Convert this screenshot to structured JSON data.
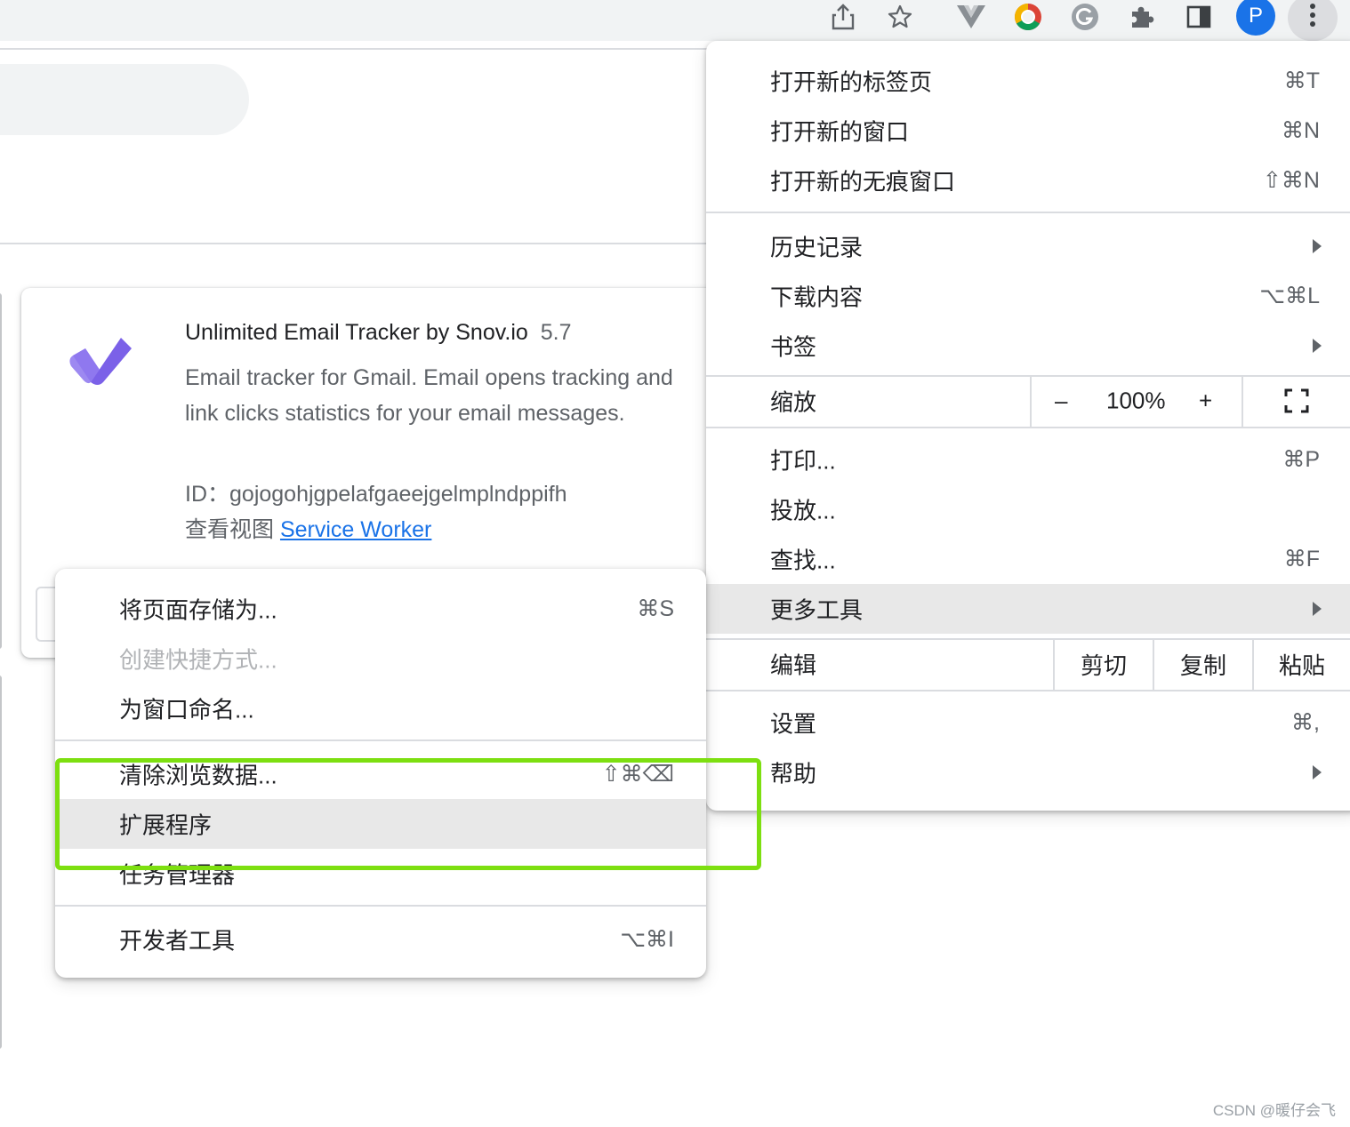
{
  "toolbar": {
    "avatar_letter": "P",
    "icons": [
      "share-icon",
      "star-icon",
      "vue-devtools-icon",
      "chrome-color-icon",
      "grammarly-icon",
      "puzzle-icon",
      "side-panel-icon",
      "avatar",
      "more-vert-icon"
    ]
  },
  "extension": {
    "name": "Unlimited Email Tracker by Snov.io",
    "version": "5.7",
    "description": "Email tracker for Gmail. Email opens tracking and link clicks statistics for your email messages.",
    "id_label": "ID：",
    "id_value": "gojogohjgpelafgaeejgelmplndppifh",
    "views_label": "查看视图",
    "service_worker_link": "Service Worker",
    "logo_color": "#7b61e8"
  },
  "main_menu": {
    "new_tab": {
      "label": "打开新的标签页",
      "shortcut": "⌘T"
    },
    "new_window": {
      "label": "打开新的窗口",
      "shortcut": "⌘N"
    },
    "new_incognito": {
      "label": "打开新的无痕窗口",
      "shortcut": "⇧⌘N"
    },
    "history": {
      "label": "历史记录"
    },
    "downloads": {
      "label": "下载内容",
      "shortcut": "⌥⌘L"
    },
    "bookmarks": {
      "label": "书签"
    },
    "zoom": {
      "label": "缩放",
      "minus": "–",
      "value": "100%",
      "plus": "+"
    },
    "print": {
      "label": "打印...",
      "shortcut": "⌘P"
    },
    "cast": {
      "label": "投放..."
    },
    "find": {
      "label": "查找...",
      "shortcut": "⌘F"
    },
    "more_tools": {
      "label": "更多工具"
    },
    "edit": {
      "label": "编辑",
      "cut": "剪切",
      "copy": "复制",
      "paste": "粘贴"
    },
    "settings": {
      "label": "设置",
      "shortcut": "⌘,"
    },
    "help": {
      "label": "帮助"
    }
  },
  "sub_menu": {
    "save_page": {
      "label": "将页面存储为...",
      "shortcut": "⌘S"
    },
    "create_shortcut": {
      "label": "创建快捷方式..."
    },
    "name_window": {
      "label": "为窗口命名..."
    },
    "clear_data": {
      "label": "清除浏览数据...",
      "shortcut": "⇧⌘⌫"
    },
    "extensions": {
      "label": "扩展程序"
    },
    "task_manager": {
      "label": "任务管理器"
    },
    "dev_tools": {
      "label": "开发者工具",
      "shortcut": "⌥⌘I"
    }
  },
  "highlight_color": "#7ddf10",
  "watermark": "CSDN @暖仔会飞"
}
